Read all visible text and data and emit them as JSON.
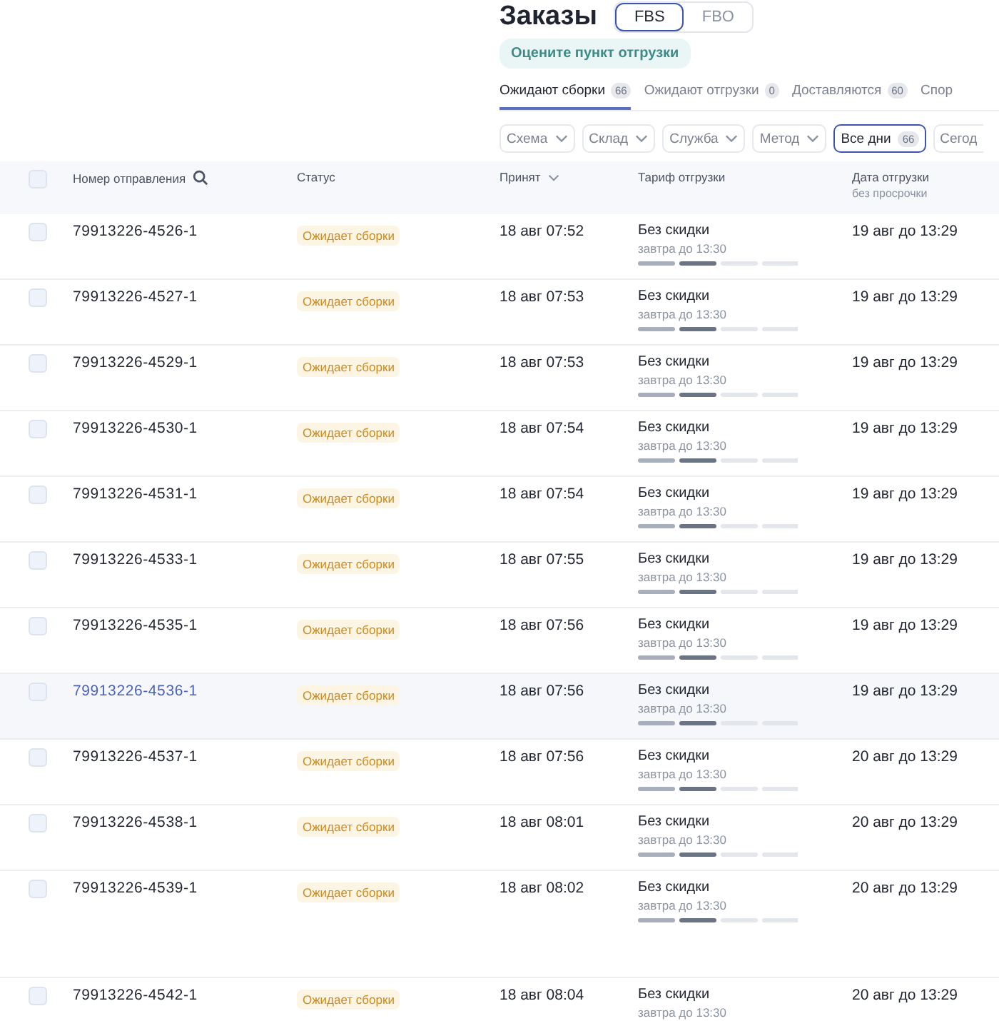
{
  "page": {
    "title": "Заказы",
    "schemes": [
      {
        "label": "FBS",
        "selected": true
      },
      {
        "label": "FBO",
        "selected": false
      }
    ],
    "rate_button": "Оцените пункт отгрузки"
  },
  "tabs": [
    {
      "label": "Ожидают сборки",
      "count": "66",
      "selected": true
    },
    {
      "label": "Ожидают отгрузки",
      "count": "0",
      "selected": false
    },
    {
      "label": "Доставляются",
      "count": "60",
      "selected": false
    },
    {
      "label": "Спор",
      "selected": false
    }
  ],
  "filters": [
    {
      "kind": "dropdown",
      "label": "Схема",
      "selected": false
    },
    {
      "kind": "dropdown",
      "label": "Склад",
      "selected": false
    },
    {
      "kind": "dropdown",
      "label": "Служба",
      "selected": false
    },
    {
      "kind": "dropdown",
      "label": "Метод",
      "selected": false
    },
    {
      "kind": "chip",
      "label": "Все дни",
      "count": "66",
      "selected": true
    },
    {
      "kind": "chip",
      "label": "Сегод",
      "selected": false
    }
  ],
  "table": {
    "select_all": {
      "checked": false
    },
    "columns": [
      {
        "label": "Номер отправления",
        "kind": "search"
      },
      {
        "label": "Статус",
        "kind": "plain"
      },
      {
        "label": "Принят",
        "kind": "sort"
      },
      {
        "label": "Тариф отгрузки",
        "kind": "plain"
      },
      {
        "label": "Дата отгрузки",
        "sub": "без просрочки",
        "kind": "plain"
      }
    ],
    "rows": [
      {
        "number": "79913226-4526-1",
        "status": "Ожидает сборки",
        "accepted": "18 авг 07:52",
        "tariff": "Без скидки",
        "deadline": "завтра до 13:30",
        "date": "19 авг до 13:29",
        "highlighted": false,
        "tall": false
      },
      {
        "number": "79913226-4527-1",
        "status": "Ожидает сборки",
        "accepted": "18 авг 07:53",
        "tariff": "Без скидки",
        "deadline": "завтра до 13:30",
        "date": "19 авг до 13:29",
        "highlighted": false,
        "tall": false
      },
      {
        "number": "79913226-4529-1",
        "status": "Ожидает сборки",
        "accepted": "18 авг 07:53",
        "tariff": "Без скидки",
        "deadline": "завтра до 13:30",
        "date": "19 авг до 13:29",
        "highlighted": false,
        "tall": false
      },
      {
        "number": "79913226-4530-1",
        "status": "Ожидает сборки",
        "accepted": "18 авг 07:54",
        "tariff": "Без скидки",
        "deadline": "завтра до 13:30",
        "date": "19 авг до 13:29",
        "highlighted": false,
        "tall": false
      },
      {
        "number": "79913226-4531-1",
        "status": "Ожидает сборки",
        "accepted": "18 авг 07:54",
        "tariff": "Без скидки",
        "deadline": "завтра до 13:30",
        "date": "19 авг до 13:29",
        "highlighted": false,
        "tall": false
      },
      {
        "number": "79913226-4533-1",
        "status": "Ожидает сборки",
        "accepted": "18 авг 07:55",
        "tariff": "Без скидки",
        "deadline": "завтра до 13:30",
        "date": "19 авг до 13:29",
        "highlighted": false,
        "tall": false
      },
      {
        "number": "79913226-4535-1",
        "status": "Ожидает сборки",
        "accepted": "18 авг 07:56",
        "tariff": "Без скидки",
        "deadline": "завтра до 13:30",
        "date": "19 авг до 13:29",
        "highlighted": false,
        "tall": false
      },
      {
        "number": "79913226-4536-1",
        "status": "Ожидает сборки",
        "accepted": "18 авг 07:56",
        "tariff": "Без скидки",
        "deadline": "завтра до 13:30",
        "date": "19 авг до 13:29",
        "highlighted": true,
        "tall": false
      },
      {
        "number": "79913226-4537-1",
        "status": "Ожидает сборки",
        "accepted": "18 авг 07:56",
        "tariff": "Без скидки",
        "deadline": "завтра до 13:30",
        "date": "20 авг до 13:29",
        "highlighted": false,
        "tall": false
      },
      {
        "number": "79913226-4538-1",
        "status": "Ожидает сборки",
        "accepted": "18 авг 08:01",
        "tariff": "Без скидки",
        "deadline": "завтра до 13:30",
        "date": "20 авг до 13:29",
        "highlighted": false,
        "tall": false
      },
      {
        "number": "79913226-4539-1",
        "status": "Ожидает сборки",
        "accepted": "18 авг 08:02",
        "tariff": "Без скидки",
        "deadline": "завтра до 13:30",
        "date": "20 авг до 13:29",
        "highlighted": false,
        "tall": true
      },
      {
        "number": "79913226-4542-1",
        "status": "Ожидает сборки",
        "accepted": "18 авг 08:04",
        "tariff": "Без скидки",
        "deadline": "завтра до 13:30",
        "date": "20 авг до 13:29",
        "highlighted": false,
        "tall": false
      }
    ]
  }
}
